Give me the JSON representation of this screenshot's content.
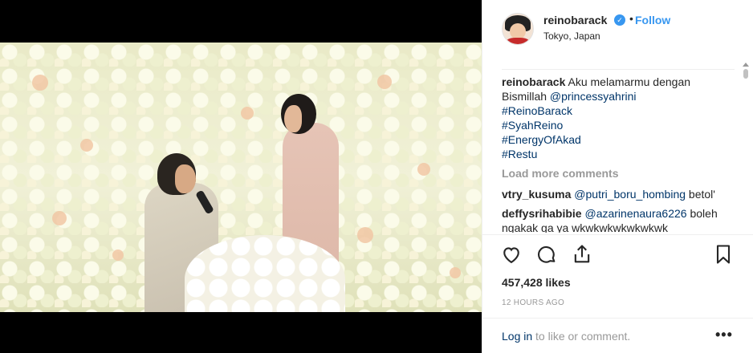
{
  "post": {
    "media_alt": "photo",
    "author": {
      "username": "reinobarack",
      "verified": true,
      "follow_label": "Follow",
      "location": "Tokyo, Japan"
    },
    "caption": {
      "username": "reinobarack",
      "text": "Aku melamarmu dengan Bismillah",
      "mention": "@princessyahrini",
      "hashtags": [
        "#ReinoBarack",
        "#SyahReino",
        "#EnergyOfAkad",
        "#Restu"
      ]
    },
    "load_more_label": "Load more comments",
    "comments": [
      {
        "username": "vtry_kusuma",
        "mention": "@putri_boru_hombing",
        "text": "betol'"
      },
      {
        "username": "deffysrihabibie",
        "mention": "@azarinenaura6226",
        "text": "boleh ngakak ga ya wkwkwkwkwkwkwk"
      }
    ],
    "likes": "457,428 likes",
    "time_ago": "12 HOURS AGO",
    "login_link": "Log in",
    "login_suffix": " to like or comment.",
    "more_options": "•••"
  },
  "icons": {
    "like": "heart-icon",
    "comment": "comment-bubble-icon",
    "share": "share-icon",
    "save": "bookmark-icon"
  },
  "colors": {
    "link": "#003569",
    "accent": "#3897f0",
    "muted": "#999999"
  }
}
